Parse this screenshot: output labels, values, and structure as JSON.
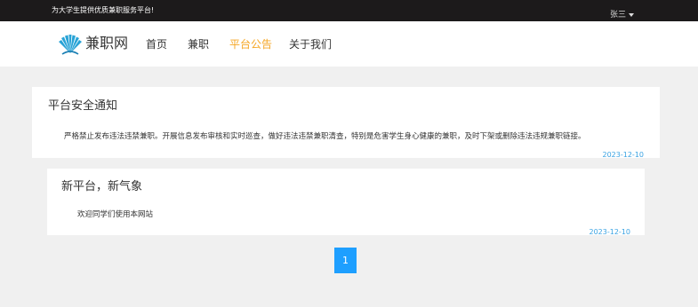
{
  "topbar": {
    "slogan": "为大学生提供优质兼职服务平台!",
    "user": "张三"
  },
  "header": {
    "logo_text": "兼职网",
    "nav": [
      {
        "label": "首页",
        "active": false
      },
      {
        "label": "兼职",
        "active": false
      },
      {
        "label": "平台公告",
        "active": true
      },
      {
        "label": "关于我们",
        "active": false
      }
    ]
  },
  "notices": [
    {
      "title": "平台安全通知",
      "content": "严格禁止发布违法违禁兼职。开展信息发布审核和实时巡查，做好违法违禁兼职清查，特别是危害学生身心健康的兼职，及时下架或删除违法违规兼职链接。",
      "date": "2023-12-10"
    },
    {
      "title": "新平台，新气象",
      "content": "欢迎同学们使用本网站",
      "date": "2023-12-10"
    }
  ],
  "pagination": {
    "current": "1"
  },
  "colors": {
    "accent": "#f5a623",
    "date": "#3aa3e3",
    "pager": "#1e9fff",
    "topbar": "#1c1a1b"
  }
}
